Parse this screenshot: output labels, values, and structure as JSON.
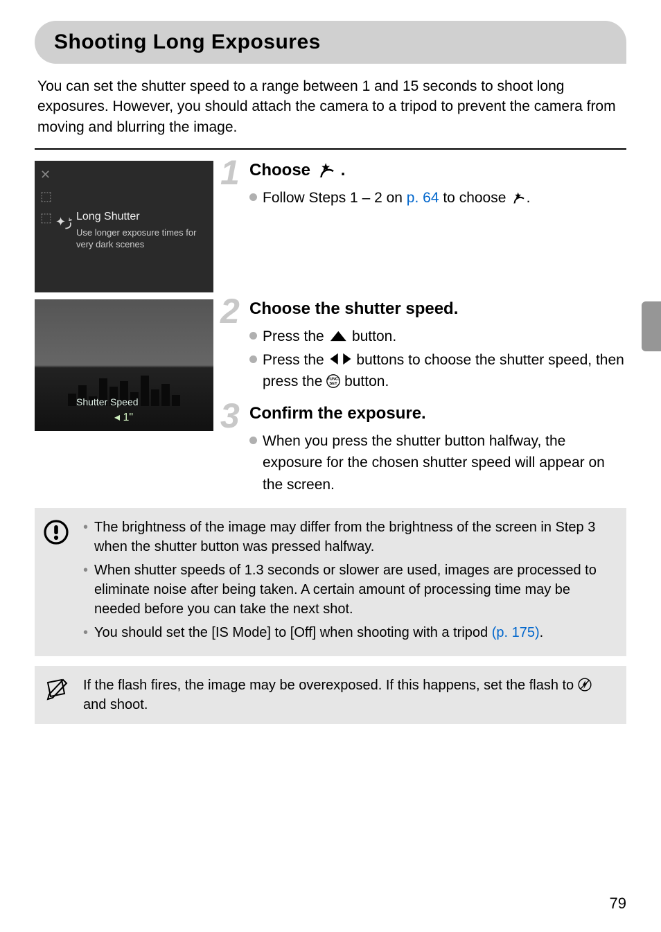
{
  "title": "Shooting Long Exposures",
  "intro": "You can set the shutter speed to a range between 1 and 15 seconds to shoot long exposures. However, you should attach the camera to a tripod to prevent the camera from moving and blurring the image.",
  "thumb1": {
    "mode_label": "Long Shutter",
    "mode_desc": "Use longer exposure times for very dark scenes"
  },
  "thumb2": {
    "label": "Shutter Speed",
    "value": "1\""
  },
  "steps": {
    "s1": {
      "num": "1",
      "head_prefix": "Choose ",
      "head_suffix": ".",
      "b1_prefix": "Follow Steps 1 – 2 on ",
      "b1_link": "p. 64",
      "b1_mid": " to choose ",
      "b1_suffix": "."
    },
    "s2": {
      "num": "2",
      "head": "Choose the shutter speed.",
      "b1_prefix": "Press the ",
      "b1_suffix": " button.",
      "b2_prefix": "Press the ",
      "b2_mid": " buttons to choose the shutter speed, then press the ",
      "b2_suffix": " button."
    },
    "s3": {
      "num": "3",
      "head": "Confirm the exposure.",
      "b1": "When you press the shutter button halfway, the exposure for the chosen shutter speed will appear on the screen."
    }
  },
  "warn": {
    "li1": "The brightness of the image may differ from the brightness of the screen in Step 3 when the shutter button was pressed halfway.",
    "li2": "When shutter speeds of 1.3 seconds or slower are used, images are processed to eliminate noise after being taken. A certain amount of processing time may be needed before you can take the next shot.",
    "li3_prefix": "You should set the [IS Mode] to [Off] when shooting with a tripod ",
    "li3_link": "(p. 175)",
    "li3_suffix": "."
  },
  "note": {
    "prefix": "If the flash fires, the image may be overexposed. If this happens, set the flash to ",
    "suffix": " and shoot."
  },
  "page_number": "79"
}
